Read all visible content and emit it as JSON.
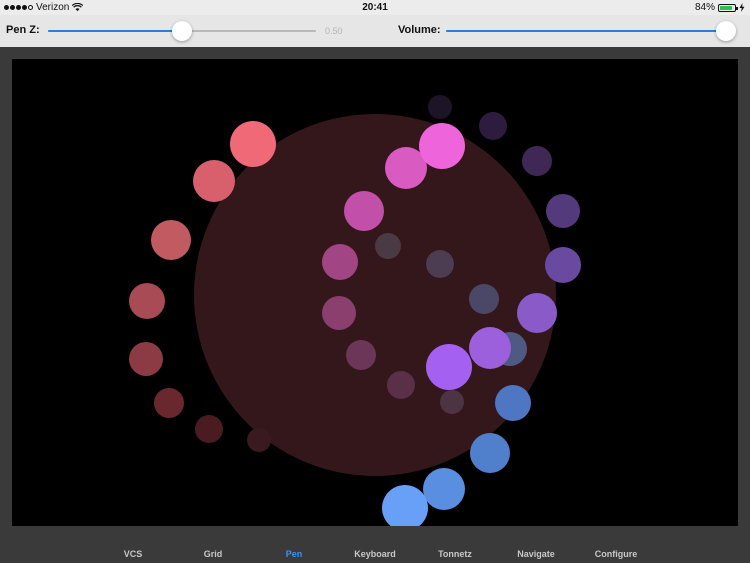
{
  "status_bar": {
    "carrier": "Verizon",
    "time": "20:41",
    "battery": "84%",
    "battery_level": 0.84
  },
  "toolbar": {
    "pen_z_label": "Pen Z:",
    "pen_z_value": "0.50",
    "pen_z_level": 0.5,
    "volume_label": "Volume:",
    "volume_level": 1.0
  },
  "tabs": [
    {
      "label": "VCS",
      "active": false
    },
    {
      "label": "Grid",
      "active": false
    },
    {
      "label": "Pen",
      "active": true
    },
    {
      "label": "Keyboard",
      "active": false
    },
    {
      "label": "Tonnetz",
      "active": false
    },
    {
      "label": "Navigate",
      "active": false
    },
    {
      "label": "Configure",
      "active": false
    }
  ],
  "colors": {
    "accent": "#2b7ce9",
    "active_tab": "#3a8fff",
    "pen_area": "#3a1a1e"
  }
}
